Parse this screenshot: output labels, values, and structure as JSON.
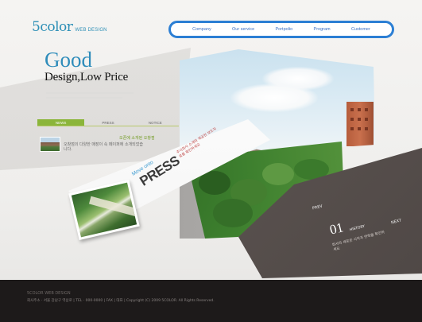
{
  "logo": {
    "brand": "5color",
    "sub": "WEB DESIGN"
  },
  "nav": [
    "Company",
    "Our service",
    "Portpolio",
    "Program",
    "Customer"
  ],
  "hero": {
    "line1": "Good",
    "line2": "Design,Low Price"
  },
  "tabs": [
    "NEWS",
    "PRESS",
    "NOTICE"
  ],
  "news": {
    "title": "오픈에 소개된 오창점",
    "body": "오창점의 다양한 매장이 속 페이퍼에 소개되었습니다."
  },
  "press": {
    "move_label": "Move onto",
    "word": "PRESS",
    "desc": "주식회사 소개와 제공된 보도자료를 확인하세요"
  },
  "history": {
    "prev": "PREV",
    "number": "01",
    "label": "HISTORY",
    "next": "NEXT",
    "text": "회사의 새로운 시작과 연혁을 확인하세요"
  },
  "footer": {
    "line1": "5COLOR WEB DESIGN",
    "line2": "회사주소 · 서울 강남구 역삼로 | TEL · 000-0000 | FAX | 대표 | Copyright (C) 2009 5COLOR. All Rights Reserved."
  },
  "colors": {
    "accent_blue": "#2c7fd4",
    "logo_blue": "#2d8fb6",
    "tab_green": "#8bb53a",
    "footer_bg": "#1d1a1a"
  }
}
